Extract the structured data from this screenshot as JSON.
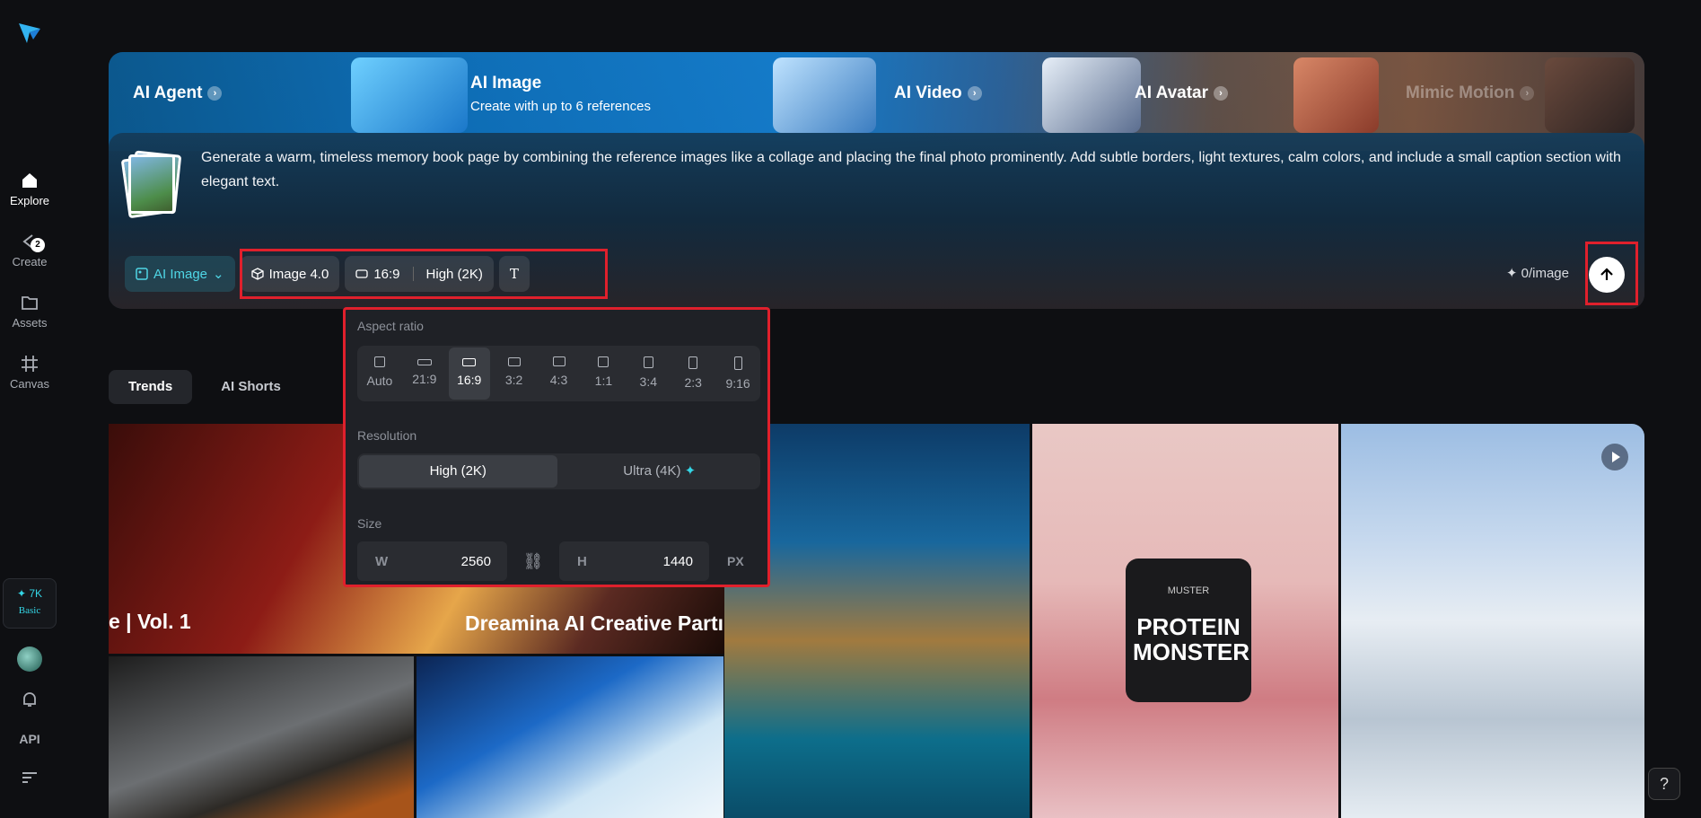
{
  "sidebar": {
    "items": [
      {
        "label": "Explore",
        "icon": "home-icon"
      },
      {
        "label": "Create",
        "icon": "create-icon"
      },
      {
        "label": "Assets",
        "icon": "folder-icon"
      },
      {
        "label": "Canvas",
        "icon": "canvas-icon"
      }
    ],
    "create_badge": "2",
    "credits": "✦ 7K",
    "plan": "Basic",
    "api_label": "API"
  },
  "hero": {
    "tabs": [
      {
        "label": "AI Agent"
      },
      {
        "label": "AI Image",
        "subtitle": "Create with up to 6 references"
      },
      {
        "label": "AI Video"
      },
      {
        "label": "AI Avatar"
      },
      {
        "label": "Mimic Motion"
      }
    ],
    "prompt": "Generate a warm, timeless memory book page by combining the reference images like a collage and placing the final photo prominently. Add subtle borders, light textures, calm colors, and include a small caption section with elegant text.",
    "controls": {
      "mode": "AI Image",
      "model": "Image 4.0",
      "ratio": "16:9",
      "quality": "High (2K)",
      "cost": "✦ 0/image"
    }
  },
  "popup": {
    "aspect_label": "Aspect ratio",
    "ratios": [
      "Auto",
      "21:9",
      "16:9",
      "3:2",
      "4:3",
      "1:1",
      "3:4",
      "2:3",
      "9:16"
    ],
    "selected_ratio": "16:9",
    "resolution_label": "Resolution",
    "res_high": "High (2K)",
    "res_ultra": "Ultra (4K)",
    "size_label": "Size",
    "w_label": "W",
    "w_value": "2560",
    "h_label": "H",
    "h_value": "1440",
    "unit": "PX"
  },
  "trends": {
    "tabs": [
      "Trends",
      "AI Shorts"
    ]
  },
  "gallery": {
    "caption_left": "e | Vol. 1",
    "caption_right": "Dreamina AI Creative Partı",
    "product_text": "PROTEIN MONSTER",
    "product_brand": "MUSTER"
  },
  "help": "?"
}
